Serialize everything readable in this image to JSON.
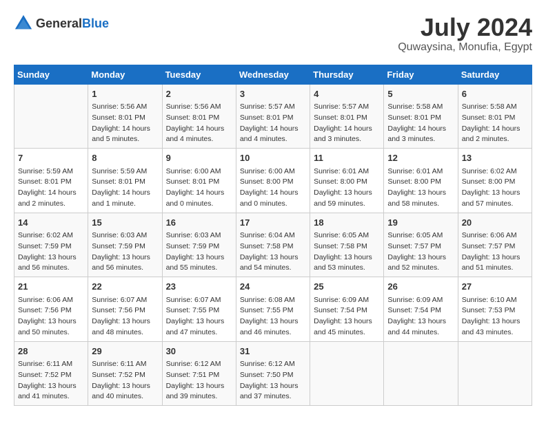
{
  "header": {
    "logo_general": "General",
    "logo_blue": "Blue",
    "title": "July 2024",
    "subtitle": "Quwaysina, Monufia, Egypt"
  },
  "days_of_week": [
    "Sunday",
    "Monday",
    "Tuesday",
    "Wednesday",
    "Thursday",
    "Friday",
    "Saturday"
  ],
  "weeks": [
    [
      {
        "day": "",
        "info": ""
      },
      {
        "day": "1",
        "info": "Sunrise: 5:56 AM\nSunset: 8:01 PM\nDaylight: 14 hours\nand 5 minutes."
      },
      {
        "day": "2",
        "info": "Sunrise: 5:56 AM\nSunset: 8:01 PM\nDaylight: 14 hours\nand 4 minutes."
      },
      {
        "day": "3",
        "info": "Sunrise: 5:57 AM\nSunset: 8:01 PM\nDaylight: 14 hours\nand 4 minutes."
      },
      {
        "day": "4",
        "info": "Sunrise: 5:57 AM\nSunset: 8:01 PM\nDaylight: 14 hours\nand 3 minutes."
      },
      {
        "day": "5",
        "info": "Sunrise: 5:58 AM\nSunset: 8:01 PM\nDaylight: 14 hours\nand 3 minutes."
      },
      {
        "day": "6",
        "info": "Sunrise: 5:58 AM\nSunset: 8:01 PM\nDaylight: 14 hours\nand 2 minutes."
      }
    ],
    [
      {
        "day": "7",
        "info": "Sunrise: 5:59 AM\nSunset: 8:01 PM\nDaylight: 14 hours\nand 2 minutes."
      },
      {
        "day": "8",
        "info": "Sunrise: 5:59 AM\nSunset: 8:01 PM\nDaylight: 14 hours\nand 1 minute."
      },
      {
        "day": "9",
        "info": "Sunrise: 6:00 AM\nSunset: 8:01 PM\nDaylight: 14 hours\nand 0 minutes."
      },
      {
        "day": "10",
        "info": "Sunrise: 6:00 AM\nSunset: 8:00 PM\nDaylight: 14 hours\nand 0 minutes."
      },
      {
        "day": "11",
        "info": "Sunrise: 6:01 AM\nSunset: 8:00 PM\nDaylight: 13 hours\nand 59 minutes."
      },
      {
        "day": "12",
        "info": "Sunrise: 6:01 AM\nSunset: 8:00 PM\nDaylight: 13 hours\nand 58 minutes."
      },
      {
        "day": "13",
        "info": "Sunrise: 6:02 AM\nSunset: 8:00 PM\nDaylight: 13 hours\nand 57 minutes."
      }
    ],
    [
      {
        "day": "14",
        "info": "Sunrise: 6:02 AM\nSunset: 7:59 PM\nDaylight: 13 hours\nand 56 minutes."
      },
      {
        "day": "15",
        "info": "Sunrise: 6:03 AM\nSunset: 7:59 PM\nDaylight: 13 hours\nand 56 minutes."
      },
      {
        "day": "16",
        "info": "Sunrise: 6:03 AM\nSunset: 7:59 PM\nDaylight: 13 hours\nand 55 minutes."
      },
      {
        "day": "17",
        "info": "Sunrise: 6:04 AM\nSunset: 7:58 PM\nDaylight: 13 hours\nand 54 minutes."
      },
      {
        "day": "18",
        "info": "Sunrise: 6:05 AM\nSunset: 7:58 PM\nDaylight: 13 hours\nand 53 minutes."
      },
      {
        "day": "19",
        "info": "Sunrise: 6:05 AM\nSunset: 7:57 PM\nDaylight: 13 hours\nand 52 minutes."
      },
      {
        "day": "20",
        "info": "Sunrise: 6:06 AM\nSunset: 7:57 PM\nDaylight: 13 hours\nand 51 minutes."
      }
    ],
    [
      {
        "day": "21",
        "info": "Sunrise: 6:06 AM\nSunset: 7:56 PM\nDaylight: 13 hours\nand 50 minutes."
      },
      {
        "day": "22",
        "info": "Sunrise: 6:07 AM\nSunset: 7:56 PM\nDaylight: 13 hours\nand 48 minutes."
      },
      {
        "day": "23",
        "info": "Sunrise: 6:07 AM\nSunset: 7:55 PM\nDaylight: 13 hours\nand 47 minutes."
      },
      {
        "day": "24",
        "info": "Sunrise: 6:08 AM\nSunset: 7:55 PM\nDaylight: 13 hours\nand 46 minutes."
      },
      {
        "day": "25",
        "info": "Sunrise: 6:09 AM\nSunset: 7:54 PM\nDaylight: 13 hours\nand 45 minutes."
      },
      {
        "day": "26",
        "info": "Sunrise: 6:09 AM\nSunset: 7:54 PM\nDaylight: 13 hours\nand 44 minutes."
      },
      {
        "day": "27",
        "info": "Sunrise: 6:10 AM\nSunset: 7:53 PM\nDaylight: 13 hours\nand 43 minutes."
      }
    ],
    [
      {
        "day": "28",
        "info": "Sunrise: 6:11 AM\nSunset: 7:52 PM\nDaylight: 13 hours\nand 41 minutes."
      },
      {
        "day": "29",
        "info": "Sunrise: 6:11 AM\nSunset: 7:52 PM\nDaylight: 13 hours\nand 40 minutes."
      },
      {
        "day": "30",
        "info": "Sunrise: 6:12 AM\nSunset: 7:51 PM\nDaylight: 13 hours\nand 39 minutes."
      },
      {
        "day": "31",
        "info": "Sunrise: 6:12 AM\nSunset: 7:50 PM\nDaylight: 13 hours\nand 37 minutes."
      },
      {
        "day": "",
        "info": ""
      },
      {
        "day": "",
        "info": ""
      },
      {
        "day": "",
        "info": ""
      }
    ]
  ]
}
